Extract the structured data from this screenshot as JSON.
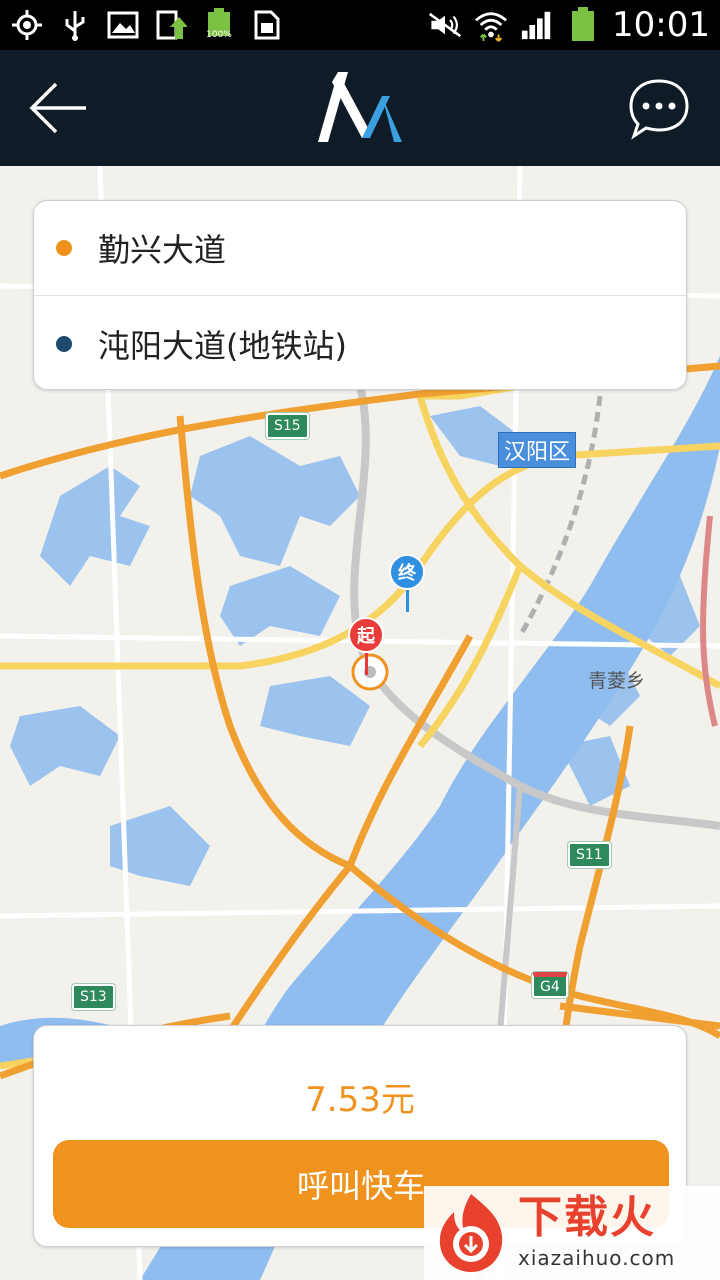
{
  "status_bar": {
    "time": "10:01",
    "battery_label": "100%"
  },
  "app_bar": {
    "back_icon": "arrow-left-icon",
    "logo_icon": "app-logo-icon",
    "message_icon": "chat-bubble-icon"
  },
  "route": {
    "origin": "勤兴大道",
    "destination": "沌阳大道(地铁站)"
  },
  "map": {
    "district_label": "汉阳区",
    "place_label": "青菱乡",
    "road_signs": [
      "S15",
      "S11",
      "G4",
      "S13"
    ],
    "start_pin_label": "起",
    "end_pin_label": "终"
  },
  "fare": {
    "price": "7.53元",
    "call_button": "呼叫快车"
  },
  "watermark": {
    "cn": "下载火",
    "en": "xiazaihuo.com"
  },
  "colors": {
    "accent": "#f0921e",
    "origin_dot": "#f0921e",
    "destination_dot": "#1e4a6e",
    "start_pin": "#ea3b3b",
    "end_pin": "#2f8fe0",
    "app_bar_bg": "#0f1b26"
  }
}
